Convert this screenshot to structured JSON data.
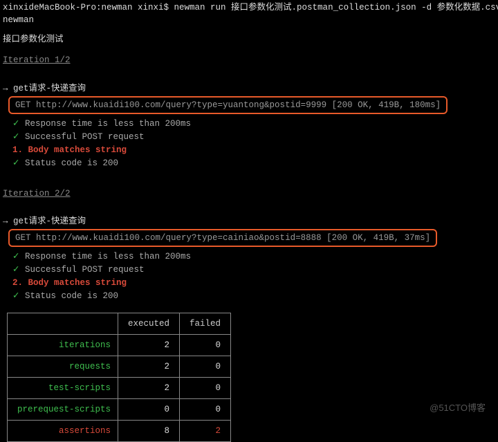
{
  "prompt": "xinxideMacBook-Pro:newman xinxi$ newman run 接口参数化测试.postman_collection.json -d 参数化数据.csv",
  "runner": "newman",
  "collection_title": "接口参数化测试",
  "iterations": [
    {
      "header": "Iteration 1/2",
      "request_label": "→ get请求-快递查询",
      "request_line": "GET http://www.kuaidi100.com/query?type=yuantong&postid=9999 [200 OK, 419B, 180ms]",
      "tests": [
        {
          "status": "pass",
          "text": "Response time is less than 200ms"
        },
        {
          "status": "pass",
          "text": "Successful POST request"
        },
        {
          "status": "fail",
          "num": "1.",
          "text": "Body matches string"
        },
        {
          "status": "pass",
          "text": "Status code is 200"
        }
      ]
    },
    {
      "header": "Iteration 2/2",
      "request_label": "→ get请求-快递查询",
      "request_line": "GET http://www.kuaidi100.com/query?type=cainiao&postid=8888 [200 OK, 419B, 37ms]",
      "tests": [
        {
          "status": "pass",
          "text": "Response time is less than 200ms"
        },
        {
          "status": "pass",
          "text": "Successful POST request"
        },
        {
          "status": "fail",
          "num": "2.",
          "text": "Body matches string"
        },
        {
          "status": "pass",
          "text": "Status code is 200"
        }
      ]
    }
  ],
  "table": {
    "headers": [
      "",
      "executed",
      "failed"
    ],
    "rows": [
      {
        "label": "iterations",
        "executed": "2",
        "failed": "0",
        "fail_red": false
      },
      {
        "label": "requests",
        "executed": "2",
        "failed": "0",
        "fail_red": false
      },
      {
        "label": "test-scripts",
        "executed": "2",
        "failed": "0",
        "fail_red": false
      },
      {
        "label": "prerequest-scripts",
        "executed": "0",
        "failed": "0",
        "fail_red": false
      },
      {
        "label": "assertions",
        "executed": "8",
        "failed": "2",
        "fail_red": true,
        "label_red": true
      }
    ]
  },
  "watermark": "@51CTO博客"
}
